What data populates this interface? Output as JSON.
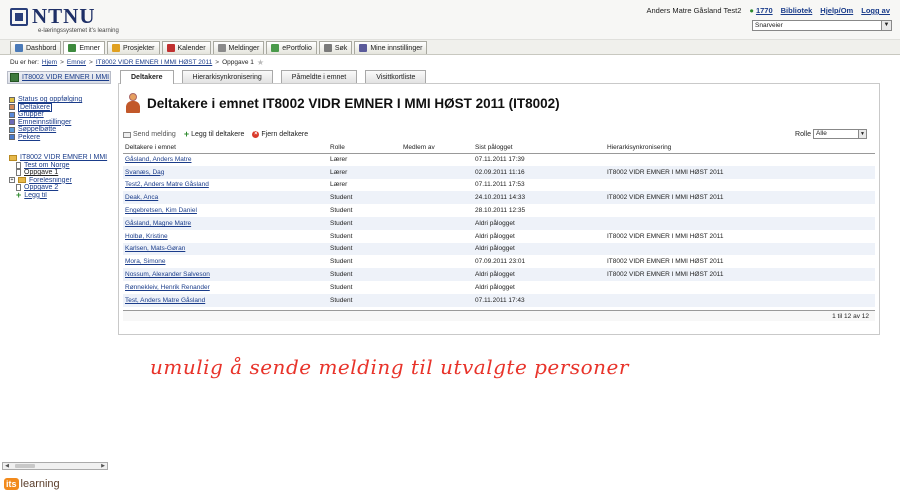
{
  "header": {
    "logo_title": "NTNU",
    "logo_subtitle": "e-læringssystemet it's learning",
    "user_name": "Anders Matre Gåsland Test2",
    "user_count": "1770",
    "links": [
      "Bibliotek",
      "Hjelp/Om",
      "Logg av"
    ],
    "shortcut_value": "Snarveier"
  },
  "nav": {
    "tabs": [
      {
        "label": "Dashbord",
        "icon": "dashboard-icon",
        "color": "#4a7ab8"
      },
      {
        "label": "Emner",
        "icon": "courses-icon",
        "color": "#3d8a3d"
      },
      {
        "label": "Prosjekter",
        "icon": "projects-icon",
        "color": "#e0a020"
      },
      {
        "label": "Kalender",
        "icon": "calendar-icon",
        "color": "#c03030"
      },
      {
        "label": "Meldinger",
        "icon": "messages-icon",
        "color": "#8a8a8a"
      },
      {
        "label": "ePortfolio",
        "icon": "eportfolio-icon",
        "color": "#4a9a4a"
      },
      {
        "label": "Søk",
        "icon": "search-icon",
        "color": "#7a7a7a"
      },
      {
        "label": "Mine innstillinger",
        "icon": "settings-icon",
        "color": "#5a5a9a"
      }
    ]
  },
  "breadcrumb": {
    "prefix": "Du er her:",
    "items": [
      "Hjem",
      "Emner",
      "IT8002 VIDR EMNER I MMI HØST 2011"
    ],
    "current": "Oppgave 1"
  },
  "sidebar": {
    "course_title": "IT8002 VIDR EMNER I MMI",
    "menu": [
      "Status og oppfølging",
      "Deltakere",
      "Grupper",
      "Emneinnstillinger",
      "Søppelbøtte",
      "Pekere"
    ],
    "tree_root": "IT8002 VIDR EMNER I MMI",
    "tree": [
      "Test om Norge",
      "Oppgave 1",
      "Forelesninger",
      "Oppgave 2",
      "Legg til"
    ]
  },
  "subtabs": [
    "Deltakere",
    "Hierarkisynkronisering",
    "Påmeldte i emnet",
    "Visittkortliste"
  ],
  "page_title": "Deltakere i emnet IT8002 VIDR EMNER I MMI HØST 2011  (IT8002)",
  "toolbar": {
    "send_message": "Send melding",
    "add_participants": "Legg til deltakere",
    "remove_participants": "Fjern deltakere",
    "role_label": "Rolle",
    "role_value": "Alle"
  },
  "table": {
    "columns": [
      "Deltakere i emnet",
      "Rolle",
      "Medlem av",
      "Sist pålogget",
      "Hierarkisynkronisering"
    ],
    "rows": [
      [
        "Gåsland, Anders Matre",
        "Lærer",
        "",
        "07.11.2011 17:39",
        ""
      ],
      [
        "Svanæs, Dag",
        "Lærer",
        "",
        "02.09.2011 11:16",
        "IT8002 VIDR EMNER I MMI HØST 2011"
      ],
      [
        "Test2, Anders Matre Gåsland",
        "Lærer",
        "",
        "07.11.2011 17:53",
        ""
      ],
      [
        "Deak, Anca",
        "Student",
        "",
        "24.10.2011 14:33",
        "IT8002 VIDR EMNER I MMI HØST 2011"
      ],
      [
        "Engebretsen, Kim Daniel",
        "Student",
        "",
        "28.10.2011 12:35",
        ""
      ],
      [
        "Gåsland, Magne Matre",
        "Student",
        "",
        "Aldri pålogget",
        ""
      ],
      [
        "Holbø, Kristine",
        "Student",
        "",
        "Aldri pålogget",
        "IT8002 VIDR EMNER I MMI HØST 2011"
      ],
      [
        "Karlsen, Mats-Gøran",
        "Student",
        "",
        "Aldri pålogget",
        ""
      ],
      [
        "Mora, Simone",
        "Student",
        "",
        "07.09.2011 23:01",
        "IT8002 VIDR EMNER I MMI HØST 2011"
      ],
      [
        "Nossum, Alexander Salveson",
        "Student",
        "",
        "Aldri pålogget",
        "IT8002 VIDR EMNER I MMI HØST 2011"
      ],
      [
        "Rønnekleiv, Henrik Renander",
        "Student",
        "",
        "Aldri pålogget",
        ""
      ],
      [
        "Test, Anders Matre Gåsland",
        "Student",
        "",
        "07.11.2011 17:43",
        ""
      ]
    ]
  },
  "pager": "1 til 12 av 12",
  "annotation": "umulig å sende melding til utvalgte personer",
  "footer": {
    "badge": "its",
    "text": "learning"
  }
}
